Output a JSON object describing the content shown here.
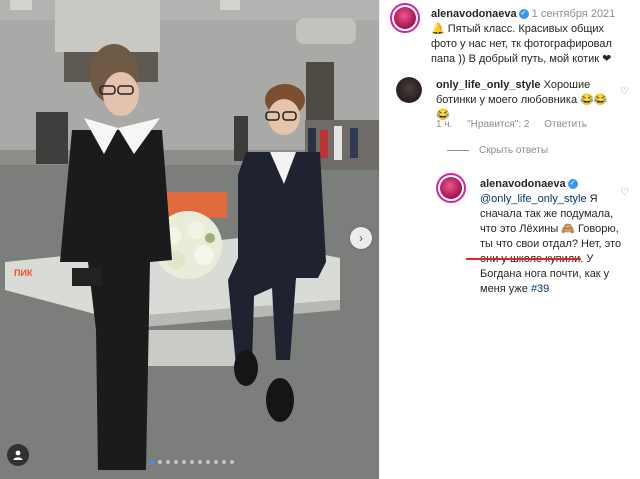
{
  "post": {
    "author": "alenavodonaeva",
    "date": "1 сентября 2021",
    "caption": "🔔 Пятый класс. Красивых общих фото у нас нет, тк фотографировал папа )) В добрый путь, мой котик ❤",
    "photo_sign": "ПИК"
  },
  "comment": {
    "author": "only_life_only_style",
    "text": "Хорошие ботинки у моего любовника 😂😂😂",
    "age": "1 ч.",
    "likes": "\"Нравится\": 2",
    "reply_label": "Ответить",
    "hide_replies": "Скрыть ответы"
  },
  "reply": {
    "author": "alenavodonaeva",
    "mention": "@only_life_only_style",
    "text_before_underline": "Я сначала так же подумала, что это Лёхины 🙈 Говорю, ты что свои отдал? Нет, это",
    "underlined": "они у школе купили",
    "text_after_underline": ". У Богдана нога почти, как у меня уже",
    "hashtag": "#39"
  },
  "carousel": {
    "count": 11,
    "active_index": 0
  },
  "colors": {
    "accent": "#3897f0",
    "link": "#00376b",
    "underline": "#e3242b",
    "ring": "#d6249f"
  },
  "icons": {
    "verified": "verified-badge-icon",
    "heart": "heart-outline-icon",
    "next": "chevron-right-icon",
    "tag": "person-tag-icon"
  }
}
